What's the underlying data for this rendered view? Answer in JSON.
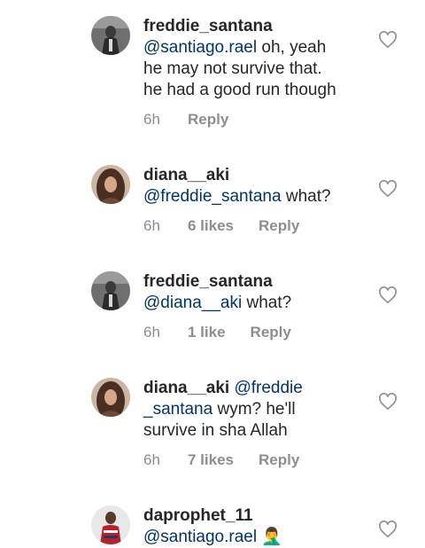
{
  "comments": [
    {
      "username": "freddie_santana",
      "mention": "@santiago.rael",
      "body_line1": " oh, yeah",
      "body_line2": "he may not survive that.",
      "body_line3": "he had a good run though",
      "time": "6h",
      "likes": "",
      "reply": "Reply"
    },
    {
      "username": "diana__aki",
      "mention": "@freddie_santana",
      "body": " what?",
      "time": "6h",
      "likes": "6 likes",
      "reply": "Reply"
    },
    {
      "username": "freddie_santana",
      "mention": "@diana__aki",
      "body": " what?",
      "time": "6h",
      "likes": "1 like",
      "reply": "Reply"
    },
    {
      "username": "diana__aki",
      "mention_part1": "@freddie",
      "mention_part2": "_santana",
      "body_a": " wym? he'll",
      "body_b": "survive in sha Allah",
      "time": "6h",
      "likes": "7 likes",
      "reply": "Reply"
    },
    {
      "username": "daprophet_11",
      "mention": "@santiago.rael",
      "emoji": "🤦‍♂️"
    }
  ],
  "icons": {
    "like": "heart-outline-icon"
  },
  "colors": {
    "mention": "#003569",
    "meta": "#8e8e8e",
    "text": "#262626"
  }
}
